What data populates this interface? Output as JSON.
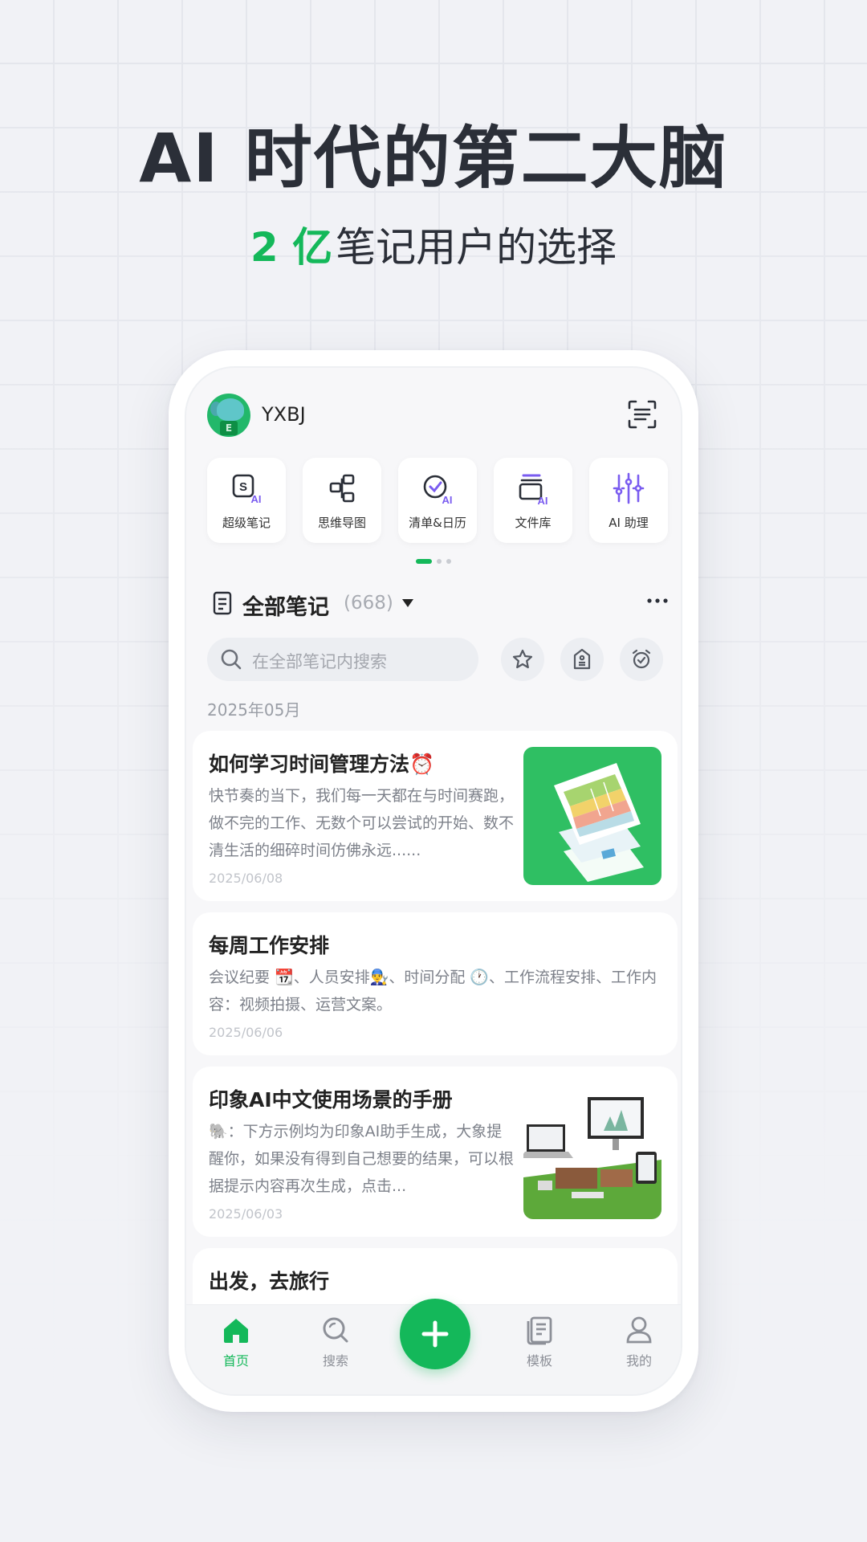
{
  "promo": {
    "headline": "AI 时代的第二大脑",
    "sub_accent": "2 亿",
    "sub_rest": "笔记用户的选择"
  },
  "colors": {
    "accent": "#14b85a",
    "ai_purple": "#7a5cf0"
  },
  "header": {
    "username": "YXBJ",
    "avatar_letter": "E",
    "scan_icon": "scan-icon"
  },
  "quick_actions": [
    {
      "label": "超级笔记",
      "icon": "super-note-ai-icon"
    },
    {
      "label": "思维导图",
      "icon": "mindmap-icon"
    },
    {
      "label": "清单&日历",
      "icon": "checklist-calendar-ai-icon"
    },
    {
      "label": "文件库",
      "icon": "file-library-ai-icon"
    },
    {
      "label": "AI 助理",
      "icon": "ai-assistant-icon"
    }
  ],
  "carousel": {
    "pages": 3,
    "active": 1
  },
  "notes": {
    "title": "全部笔记",
    "count": "(668)",
    "search_placeholder": "在全部笔记内搜索",
    "month": "2025年05月",
    "items": [
      {
        "title": "如何学习时间管理方法⏰",
        "body": "快节奏的当下，我们每一天都在与时间赛跑，做不完的工作、无数个可以尝试的开始、数不清生活的细碎时间仿佛永远......",
        "date": "2025/06/08",
        "thumbnail": "documents-illustration"
      },
      {
        "title": "每周工作安排",
        "body": "会议纪要 📆、人员安排👨‍🔧、时间分配 🕐、工作流程安排、工作内容：视频拍摄、运营文案。",
        "date": "2025/06/06"
      },
      {
        "title": "印象AI中文使用场景的手册",
        "body": "🐘：下方示例均为印象AI助手生成，大象提醒你，如果没有得到自己想要的结果，可以根据提示内容再次生成，点击...",
        "date": "2025/06/03",
        "thumbnail": "devices-illustration"
      },
      {
        "title": "出发，去旅行"
      }
    ]
  },
  "bottom_nav": {
    "home": "首页",
    "search": "搜索",
    "templates": "模板",
    "me": "我的"
  }
}
